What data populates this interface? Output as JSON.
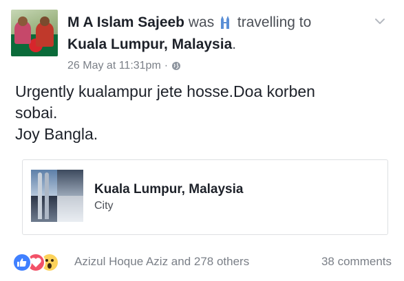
{
  "post": {
    "author": "M A Islam Sajeeb",
    "was_word": "was",
    "activity": "travelling to",
    "activity_icon": "towers-icon",
    "location": "Kuala Lumpur, Malaysia",
    "location_punct": ".",
    "timestamp": "26 May at 11:31pm",
    "separator": "·",
    "privacy_icon": "globe-icon",
    "text_lines": [
      "Urgently kualampur jete hosse.Doa korben",
      "sobai.",
      "Joy Bangla."
    ]
  },
  "place_card": {
    "name": "Kuala Lumpur, Malaysia",
    "type": "City"
  },
  "footer": {
    "reactions": [
      "like-reaction-icon",
      "love-reaction-icon",
      "wow-reaction-icon"
    ],
    "likers": "Azizul Hoque Aziz and 278 others",
    "comments": "38 comments"
  },
  "colors": {
    "text": "#1d2129",
    "secondary_text": "#4b4f56",
    "meta_text": "#7a7f87",
    "like": "#4080ff",
    "love": "#f25268",
    "wow": "#fcd25a",
    "card_border": "#dddfe2"
  }
}
